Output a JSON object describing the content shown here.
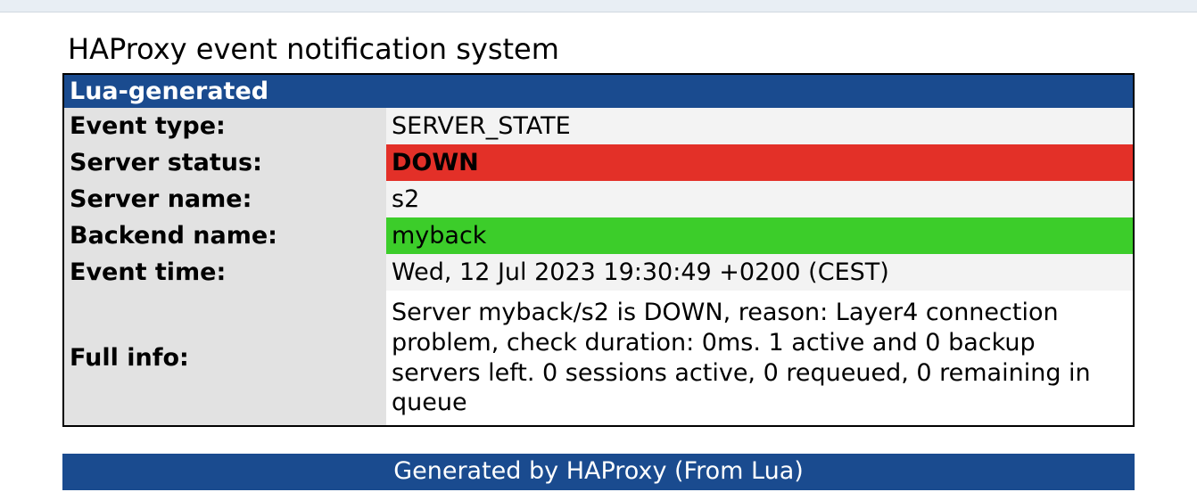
{
  "title": "HAProxy event notification system",
  "subheader": "Lua-generated",
  "rows": {
    "event_type": {
      "label": "Event type:",
      "value": "SERVER_STATE"
    },
    "server_status": {
      "label": "Server status:",
      "value": "DOWN"
    },
    "server_name": {
      "label": "Server name:",
      "value": "s2"
    },
    "backend_name": {
      "label": "Backend name:",
      "value": "myback"
    },
    "event_time": {
      "label": "Event time:",
      "value": "Wed, 12 Jul 2023 19:30:49 +0200 (CEST)"
    },
    "full_info": {
      "label": "Full info:",
      "value": "Server myback/s2 is DOWN, reason: Layer4 connection problem, check duration: 0ms. 1 active and 0 backup servers left. 0 sessions active, 0 requeued, 0 remaining in queue"
    }
  },
  "footer": "Generated by HAProxy (From Lua)"
}
